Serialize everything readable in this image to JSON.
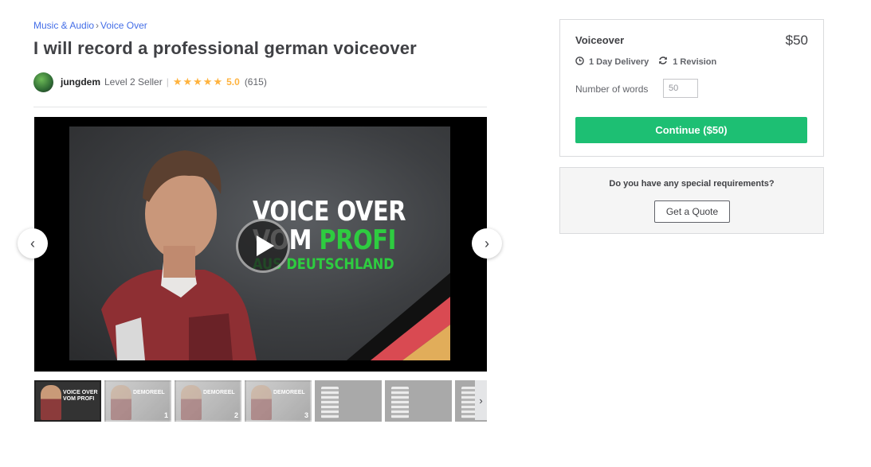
{
  "breadcrumb": {
    "category": "Music & Audio",
    "separator": "›",
    "subcategory": "Voice Over"
  },
  "gig": {
    "title": "I will record a professional german voiceover"
  },
  "seller": {
    "name": "jungdem",
    "level": "Level 2 Seller",
    "separator": "|",
    "stars": "★★★★★",
    "rating": "5.0",
    "reviews": "(615)"
  },
  "video": {
    "line1": "VOICE OVER",
    "line2a": "VOM ",
    "line2b": "PROFI",
    "line3": "AUS DEUTSCHLAND"
  },
  "gallery": {
    "prev_icon": "‹",
    "next_icon": "›",
    "strip_next_icon": "›",
    "thumbs": [
      {
        "label": "VOICE OVER VOM PROFI",
        "num": ""
      },
      {
        "label": "DEMOREEL",
        "num": "1"
      },
      {
        "label": "DEMOREEL",
        "num": "2"
      },
      {
        "label": "DEMOREEL",
        "num": "3"
      },
      {
        "label": "",
        "num": ""
      },
      {
        "label": "",
        "num": ""
      },
      {
        "label": "",
        "num": ""
      }
    ]
  },
  "package": {
    "name": "Voiceover",
    "price": "$50",
    "delivery_icon": "clock-icon",
    "delivery": "1 Day Delivery",
    "revision_icon": "refresh-icon",
    "revision": "1 Revision",
    "words_label": "Number of words",
    "words_value": "50",
    "continue_label": "Continue ($50)"
  },
  "quote": {
    "question": "Do you have any special requirements?",
    "button": "Get a Quote"
  },
  "colors": {
    "brand_green": "#1dbf73",
    "link_blue": "#446ee7",
    "star": "#ffb33e"
  }
}
